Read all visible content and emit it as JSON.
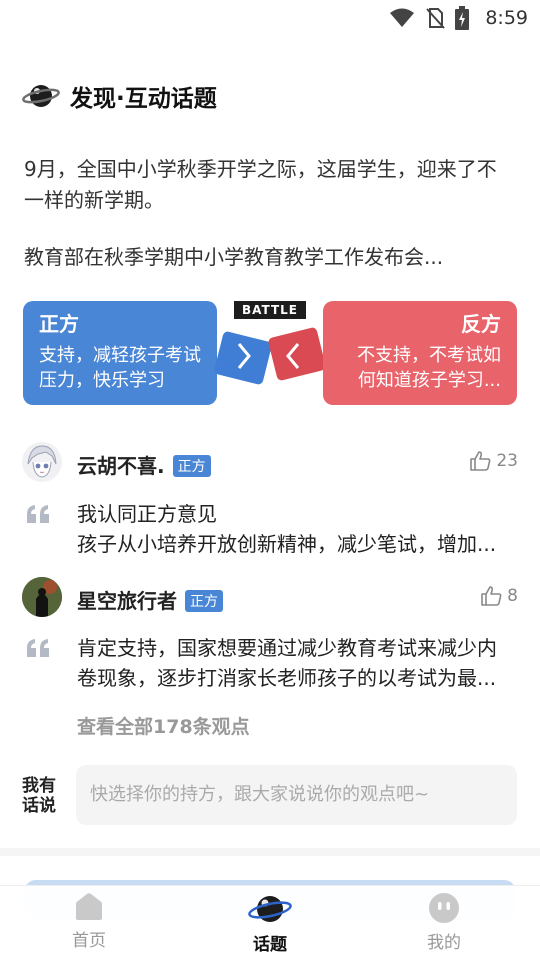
{
  "status_bar": {
    "time": "8:59"
  },
  "header": {
    "title": "发现·互动话题"
  },
  "topic": {
    "description": "9月，全国中小学秋季开学之际，这届学生，迎来了不一样的新学期。",
    "summary": "教育部在秋季学期中小学教育教学工作发布会..."
  },
  "battle": {
    "badge": "BATTLE",
    "pro": {
      "title": "正方",
      "desc": "支持，减轻孩子考试压力，快乐学习",
      "color": "#4a86d6"
    },
    "con": {
      "title": "反方",
      "desc_line1": "不支持，不考试如",
      "desc_line2": "何知道孩子学习...",
      "color": "#e9636b"
    }
  },
  "comments": [
    {
      "user": "云胡不喜.",
      "stance": "正方",
      "likes": "23",
      "lines": [
        "我认同正方意见",
        "孩子从小培养开放创新精神，减少笔试，增加..."
      ]
    },
    {
      "user": "星空旅行者",
      "stance": "正方",
      "likes": "8",
      "lines": [
        "肯定支持，国家想要通过减少教育考试来减少内",
        "卷现象，逐步打消家长老师孩子的以考试为最..."
      ]
    }
  ],
  "view_all": "查看全部178条观点",
  "say": {
    "label_line1": "我有",
    "label_line2": "话说",
    "placeholder": "快选择你的持方，跟大家说说你的观点吧~"
  },
  "tabs": [
    {
      "label": "首页",
      "icon": "home-icon",
      "active": false
    },
    {
      "label": "话题",
      "icon": "planet-icon",
      "active": true
    },
    {
      "label": "我的",
      "icon": "profile-icon",
      "active": false
    }
  ]
}
